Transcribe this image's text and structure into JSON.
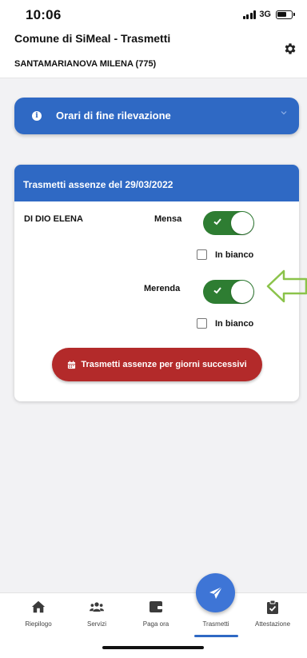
{
  "status_bar": {
    "time": "10:06",
    "network": "3G"
  },
  "header": {
    "title": "Comune di SiMeal - Trasmetti",
    "user": "SANTAMARIANOVA MILENA (775)",
    "settings_icon": "gear-icon"
  },
  "info_panel": {
    "title": "Orari di fine rilevazione",
    "icon": "info-circle-icon",
    "expanded": false
  },
  "card": {
    "header": "Trasmetti assenze del 29/03/2022",
    "person": "DI DIO ELENA",
    "services": [
      {
        "label": "Mensa",
        "enabled": true,
        "blank_label": "In bianco",
        "blank_checked": false
      },
      {
        "label": "Merenda",
        "enabled": true,
        "blank_label": "In bianco",
        "blank_checked": false
      }
    ],
    "submit_label": "Trasmetti assenze per giorni successivi"
  },
  "bottom_nav": {
    "items": [
      {
        "label": "Riepilogo",
        "icon": "home-icon"
      },
      {
        "label": "Servizi",
        "icon": "users-icon"
      },
      {
        "label": "Paga ora",
        "icon": "wallet-icon"
      },
      {
        "label": "Trasmetti",
        "icon": "send-icon",
        "active": true
      },
      {
        "label": "Attestazione",
        "icon": "clipboard-check-icon"
      }
    ]
  },
  "colors": {
    "primary": "#2f69c4",
    "toggle_on": "#2e7d32",
    "submit": "#b32a2a",
    "annotation": "#8bc34a"
  }
}
